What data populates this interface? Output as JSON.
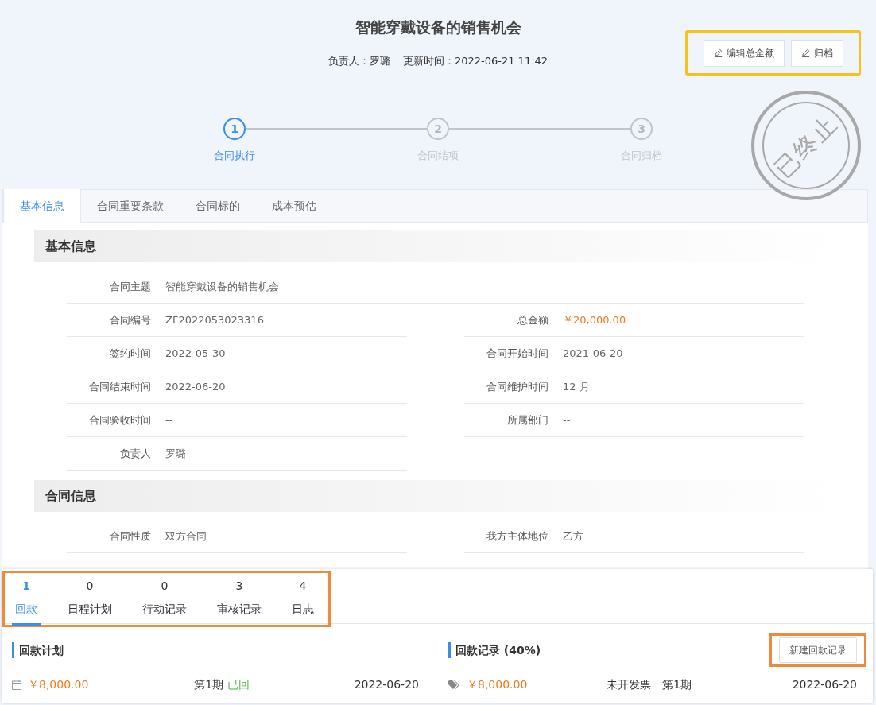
{
  "header": {
    "title": "智能穿戴设备的销售机会",
    "owner_label": "负责人：",
    "owner": "罗璐",
    "updated_label": "更新时间：",
    "updated": "2022-06-21 11:42"
  },
  "actions": [
    {
      "label": "编辑总金额"
    },
    {
      "label": "归档"
    }
  ],
  "steps": [
    {
      "number": "1",
      "label": "合同执行",
      "selected": true
    },
    {
      "number": "2",
      "label": "合同结项",
      "selected": false
    },
    {
      "number": "3",
      "label": "合同归档",
      "selected": false
    }
  ],
  "stamp": {
    "text": "已终止"
  },
  "tabs": [
    {
      "label": "基本信息",
      "selected": true
    },
    {
      "label": "合同重要条款",
      "selected": false
    },
    {
      "label": "合同标的",
      "selected": false
    },
    {
      "label": "成本预估",
      "selected": false
    }
  ],
  "sections": [
    {
      "title": "基本信息",
      "rows": [
        {
          "kind": "wide",
          "cells": [
            {
              "label": "合同主题",
              "value": "智能穿戴设备的销售机会",
              "emphasis": false
            }
          ]
        },
        {
          "kind": "pair",
          "cells": [
            {
              "label": "合同编号",
              "value": "ZF2022053023316",
              "emphasis": false
            },
            {
              "label": "总金额",
              "value": "￥20,000.00",
              "emphasis": true
            }
          ]
        },
        {
          "kind": "pair",
          "cells": [
            {
              "label": "签约时间",
              "value": "2022-05-30",
              "emphasis": false
            },
            {
              "label": "合同开始时间",
              "value": "2021-06-20",
              "emphasis": false
            }
          ]
        },
        {
          "kind": "pair",
          "cells": [
            {
              "label": "合同结束时间",
              "value": "2022-06-20",
              "emphasis": false
            },
            {
              "label": "合同维护时间",
              "value": "12 月",
              "emphasis": false
            }
          ]
        },
        {
          "kind": "pair",
          "cells": [
            {
              "label": "合同验收时间",
              "value": "--",
              "emphasis": false
            },
            {
              "label": "所属部门",
              "value": "--",
              "emphasis": false
            }
          ]
        },
        {
          "kind": "pair",
          "cells": [
            {
              "label": "负责人",
              "value": "罗璐",
              "emphasis": false
            }
          ]
        }
      ]
    },
    {
      "title": "合同信息",
      "rows": [
        {
          "kind": "pair",
          "cells": [
            {
              "label": "合同性质",
              "value": "双方合同",
              "emphasis": false
            },
            {
              "label": "我方主体地位",
              "value": "乙方",
              "emphasis": false
            }
          ]
        }
      ]
    }
  ],
  "bottom_tabs": [
    {
      "count": "1",
      "label": "回款",
      "selected": true
    },
    {
      "count": "0",
      "label": "日程计划",
      "selected": false
    },
    {
      "count": "0",
      "label": "行动记录",
      "selected": false
    },
    {
      "count": "3",
      "label": "审核记录",
      "selected": false
    },
    {
      "count": "4",
      "label": "日志",
      "selected": false
    }
  ],
  "payment_plan": {
    "title": "回款计划",
    "amount": "￥8,000.00",
    "period": "第1期",
    "status": "已回",
    "date": "2022-06-20"
  },
  "payment_records": {
    "title": "回款记录 (40%)",
    "button": "新建回款记录",
    "amount": "￥8,000.00",
    "invoice": "未开发票",
    "period": "第1期",
    "date": "2022-06-20"
  }
}
